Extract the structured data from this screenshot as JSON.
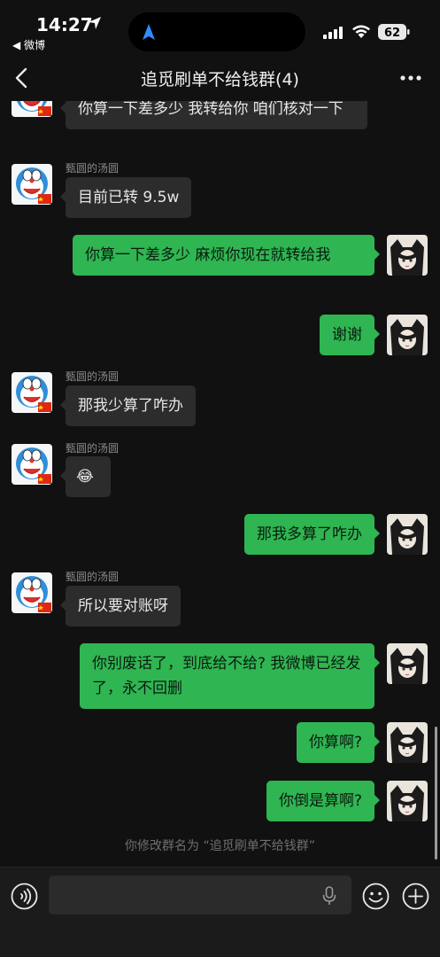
{
  "status_bar": {
    "time": "14:27",
    "back_app": "◀ 微博",
    "battery": "62"
  },
  "nav": {
    "title": "追觅刷单不给钱群(4)"
  },
  "messages": [
    {
      "side": "in",
      "sender": "",
      "text": "你算一下差多少 我转给你 咱们核对一下"
    },
    {
      "side": "in",
      "sender": "甄圆的汤圆",
      "text": "目前已转 9.5w"
    },
    {
      "side": "out",
      "text": "你算一下差多少 麻烦你现在就转给我"
    },
    {
      "side": "out",
      "text": "谢谢"
    },
    {
      "side": "in",
      "sender": "甄圆的汤圆",
      "text": "那我少算了咋办"
    },
    {
      "side": "in",
      "sender": "甄圆的汤圆",
      "text": "😂"
    },
    {
      "side": "out",
      "text": "那我多算了咋办"
    },
    {
      "side": "in",
      "sender": "甄圆的汤圆",
      "text": "所以要对账呀"
    },
    {
      "side": "out",
      "text": "你别废话了，到底给不给? 我微博已经发了，永不回删"
    },
    {
      "side": "out",
      "text": "你算啊?"
    },
    {
      "side": "out",
      "text": "你倒是算啊?"
    }
  ],
  "system_message": "你修改群名为 “追觅刷单不给钱群”",
  "input_bar": {
    "placeholder": ""
  },
  "colors": {
    "background": "#111111",
    "bubble_out": "#2fb552",
    "bubble_in": "#2c2c2c"
  },
  "icons": [
    "location-arrow-icon",
    "navigation-icon",
    "signal-icon",
    "wifi-icon",
    "battery-icon",
    "back-chevron-icon",
    "more-dots-icon",
    "doraemon-avatar",
    "cat-girl-avatar",
    "voice-icon",
    "microphone-icon",
    "emoji-icon",
    "plus-icon"
  ]
}
